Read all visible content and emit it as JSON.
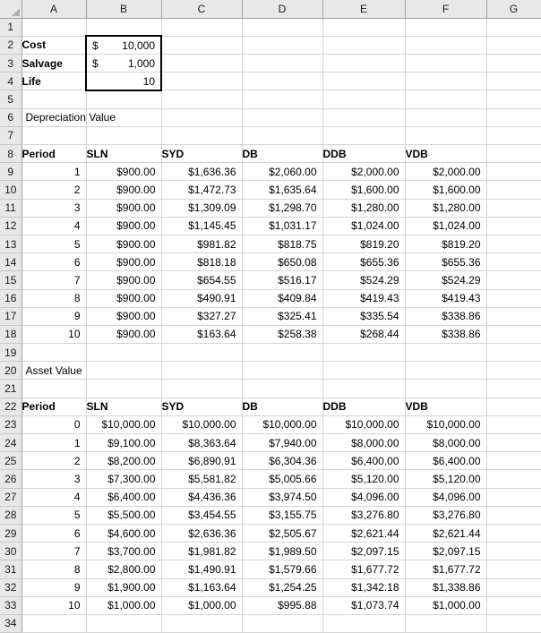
{
  "app": {
    "type": "spreadsheet",
    "select_all_icon": "select-all-triangle-icon"
  },
  "columns": [
    "A",
    "B",
    "C",
    "D",
    "E",
    "F",
    "G"
  ],
  "row_numbers": [
    1,
    2,
    3,
    4,
    5,
    6,
    7,
    8,
    9,
    10,
    11,
    12,
    13,
    14,
    15,
    16,
    17,
    18,
    19,
    20,
    21,
    22,
    23,
    24,
    25,
    26,
    27,
    28,
    29,
    30,
    31,
    32,
    33,
    34
  ],
  "inputs": {
    "cost_label": "Cost",
    "cost_currency": "$",
    "cost_value": "10,000",
    "salvage_label": "Salvage",
    "salvage_currency": "$",
    "salvage_value": "1,000",
    "life_label": "Life",
    "life_value": "10"
  },
  "section_depreciation": {
    "title": "Depreciation Value",
    "headers": [
      "Period",
      "SLN",
      "SYD",
      "DB",
      "DDB",
      "VDB"
    ],
    "rows": [
      [
        "1",
        "$900.00",
        "$1,636.36",
        "$2,060.00",
        "$2,000.00",
        "$2,000.00"
      ],
      [
        "2",
        "$900.00",
        "$1,472.73",
        "$1,635.64",
        "$1,600.00",
        "$1,600.00"
      ],
      [
        "3",
        "$900.00",
        "$1,309.09",
        "$1,298.70",
        "$1,280.00",
        "$1,280.00"
      ],
      [
        "4",
        "$900.00",
        "$1,145.45",
        "$1,031.17",
        "$1,024.00",
        "$1,024.00"
      ],
      [
        "5",
        "$900.00",
        "$981.82",
        "$818.75",
        "$819.20",
        "$819.20"
      ],
      [
        "6",
        "$900.00",
        "$818.18",
        "$650.08",
        "$655.36",
        "$655.36"
      ],
      [
        "7",
        "$900.00",
        "$654.55",
        "$516.17",
        "$524.29",
        "$524.29"
      ],
      [
        "8",
        "$900.00",
        "$490.91",
        "$409.84",
        "$419.43",
        "$419.43"
      ],
      [
        "9",
        "$900.00",
        "$327.27",
        "$325.41",
        "$335.54",
        "$338.86"
      ],
      [
        "10",
        "$900.00",
        "$163.64",
        "$258.38",
        "$268.44",
        "$338.86"
      ]
    ]
  },
  "section_asset": {
    "title": "Asset Value",
    "headers": [
      "Period",
      "SLN",
      "SYD",
      "DB",
      "DDB",
      "VDB"
    ],
    "rows": [
      [
        "0",
        "$10,000.00",
        "$10,000.00",
        "$10,000.00",
        "$10,000.00",
        "$10,000.00"
      ],
      [
        "1",
        "$9,100.00",
        "$8,363.64",
        "$7,940.00",
        "$8,000.00",
        "$8,000.00"
      ],
      [
        "2",
        "$8,200.00",
        "$6,890.91",
        "$6,304.36",
        "$6,400.00",
        "$6,400.00"
      ],
      [
        "3",
        "$7,300.00",
        "$5,581.82",
        "$5,005.66",
        "$5,120.00",
        "$5,120.00"
      ],
      [
        "4",
        "$6,400.00",
        "$4,436.36",
        "$3,974.50",
        "$4,096.00",
        "$4,096.00"
      ],
      [
        "5",
        "$5,500.00",
        "$3,454.55",
        "$3,155.75",
        "$3,276.80",
        "$3,276.80"
      ],
      [
        "6",
        "$4,600.00",
        "$2,636.36",
        "$2,505.67",
        "$2,621.44",
        "$2,621.44"
      ],
      [
        "7",
        "$3,700.00",
        "$1,981.82",
        "$1,989.50",
        "$2,097.15",
        "$2,097.15"
      ],
      [
        "8",
        "$2,800.00",
        "$1,490.91",
        "$1,579.66",
        "$1,677.72",
        "$1,677.72"
      ],
      [
        "9",
        "$1,900.00",
        "$1,163.64",
        "$1,254.25",
        "$1,342.18",
        "$1,338.86"
      ],
      [
        "10",
        "$1,000.00",
        "$1,000.00",
        "$995.88",
        "$1,073.74",
        "$1,000.00"
      ]
    ]
  },
  "colors": {
    "header_bg": "#e8e8e8",
    "gridline": "#d4d4d4",
    "header_border": "#a0a0a0",
    "box_border": "#000000",
    "text": "#000000"
  }
}
